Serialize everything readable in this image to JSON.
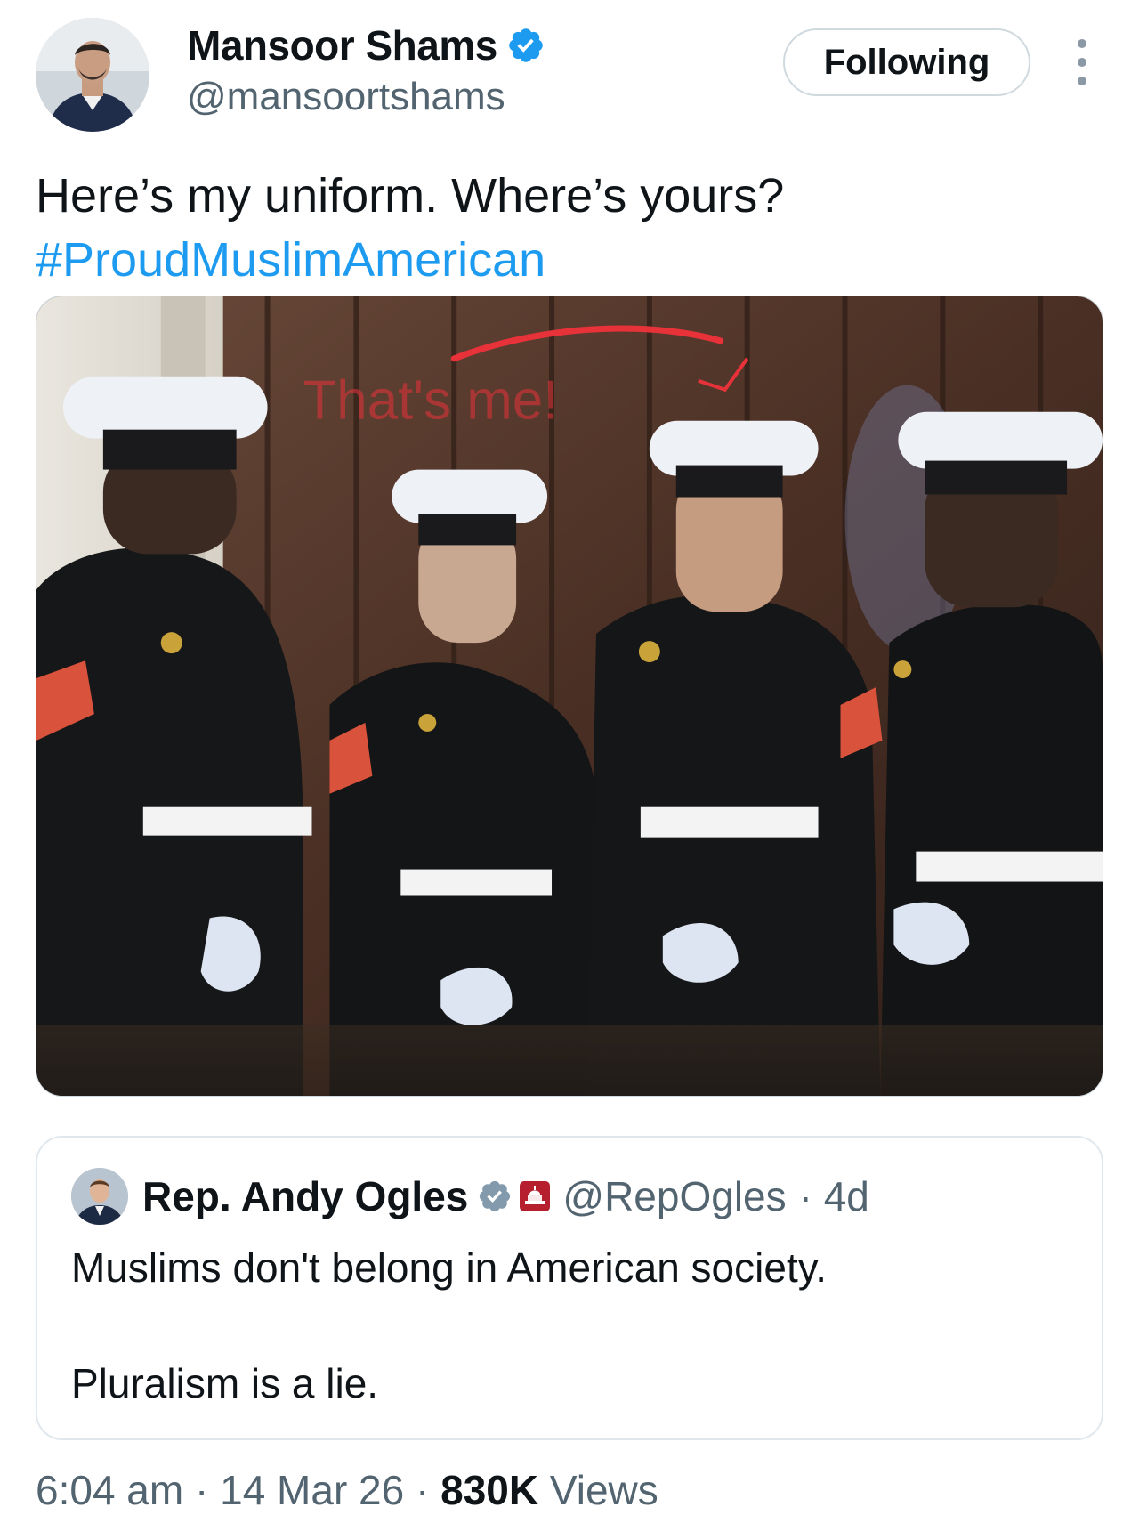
{
  "author": {
    "name": "Mansoor Shams",
    "handle": "@mansoortshams",
    "verified_color": "#1d9bf0"
  },
  "follow_button": {
    "label": "Following"
  },
  "more_icon": "more-vertical-icon",
  "tweet": {
    "text": "Here’s my uniform. Where’s yours?",
    "hashtag": "#ProudMuslimAmerican"
  },
  "media": {
    "annotation_text": "That's me!",
    "annotation_color": "#e8323a"
  },
  "quoted_tweet": {
    "name": "Rep. Andy Ogles",
    "verified_color": "#829aab",
    "badge_icon": "capitol-badge-icon",
    "handle": "@RepOgles",
    "time": "· 4d",
    "text_line1": "Muslims don't belong in American society.",
    "text_line2": "Pluralism is a lie."
  },
  "meta": {
    "time": "6:04 am",
    "date": "14 Mar 26",
    "views_count": "830K",
    "views_label": "Views"
  },
  "colors": {
    "link": "#1d9bf0",
    "secondary_text": "#536471",
    "primary_text": "#0f1419"
  }
}
